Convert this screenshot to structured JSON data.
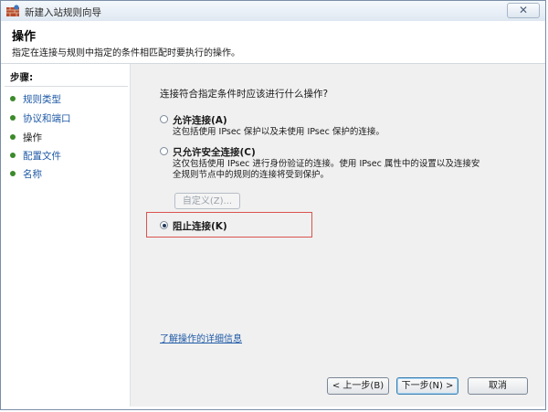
{
  "window": {
    "title": "新建入站规则向导",
    "close_glyph": "✕"
  },
  "header": {
    "title": "操作",
    "description": "指定在连接与规则中指定的条件相匹配时要执行的操作。"
  },
  "steps": {
    "title": "步骤:",
    "items": [
      {
        "label": "规则类型",
        "current": false
      },
      {
        "label": "协议和端口",
        "current": false
      },
      {
        "label": "操作",
        "current": true
      },
      {
        "label": "配置文件",
        "current": false
      },
      {
        "label": "名称",
        "current": false
      }
    ]
  },
  "main": {
    "question": "连接符合指定条件时应该进行什么操作?",
    "options": [
      {
        "label": "允许连接(A)",
        "desc": [
          "这包括使用 IPsec 保护以及未使用 IPsec 保护的连接。"
        ],
        "checked": false
      },
      {
        "label": "只允许安全连接(C)",
        "desc": [
          "这仅包括使用 IPsec 进行身份验证的连接。使用 IPsec 属性中的设置以及连接安",
          "全规则节点中的规则的连接将受到保护。"
        ],
        "checked": false
      },
      {
        "label": "阻止连接(K)",
        "desc": [],
        "checked": true
      }
    ],
    "custom_button": "自定义(Z)...",
    "learn_more_link": "了解操作的详细信息"
  },
  "buttons": {
    "back": "< 上一步(B)",
    "next": "下一步(N) >",
    "cancel": "取消"
  },
  "colors": {
    "link": "#1f5aa6",
    "highlight_border": "#d9534f",
    "step_bullet": "#3c8a2a"
  }
}
